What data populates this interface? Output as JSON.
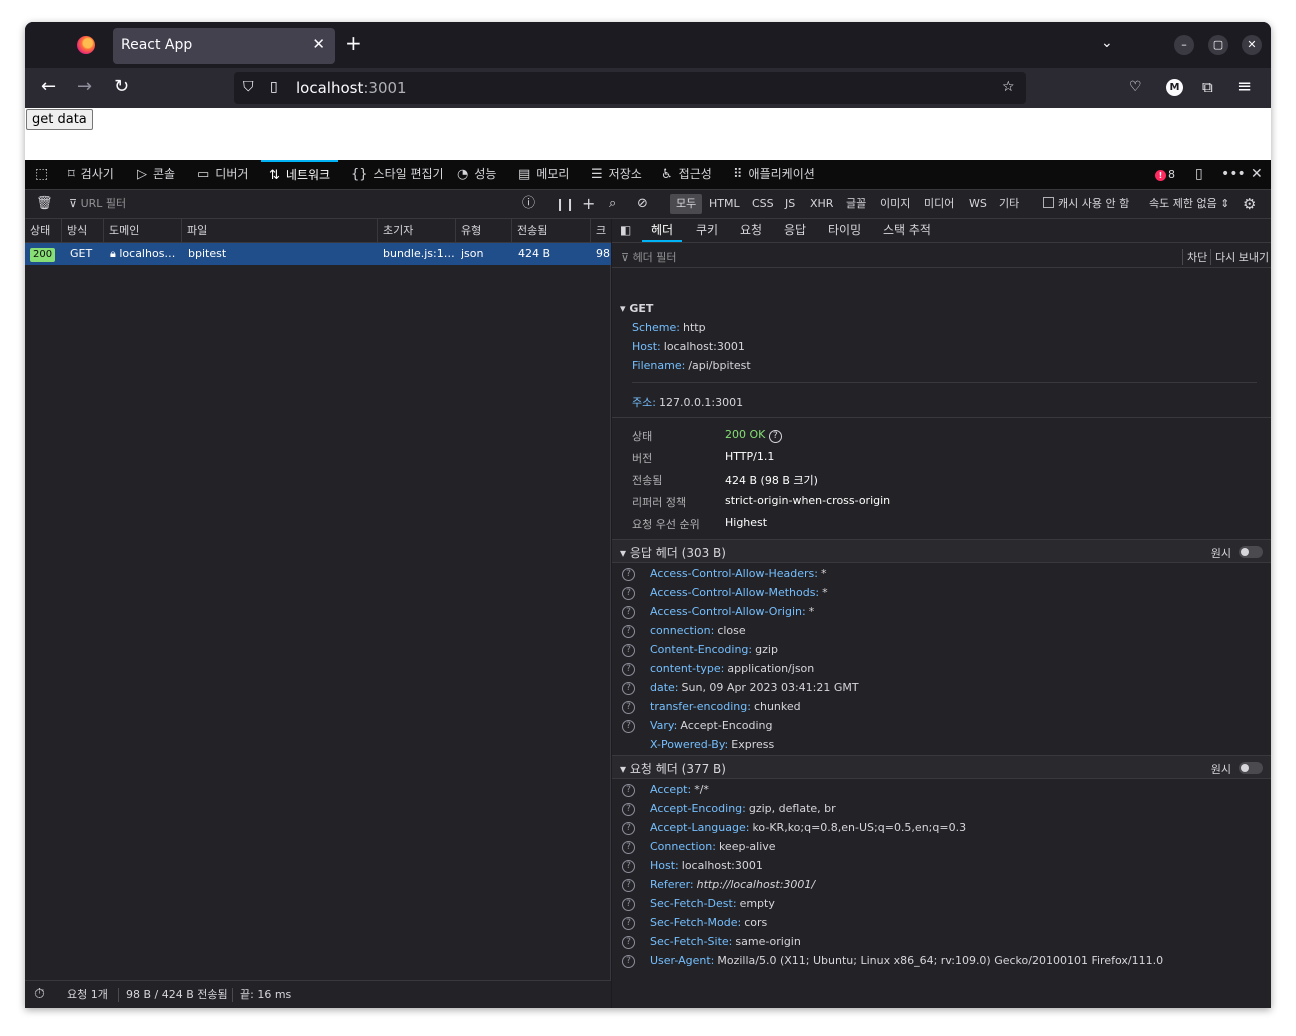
{
  "browser": {
    "tab_title": "React App",
    "url_host": "localhost",
    "url_port": ":3001"
  },
  "page": {
    "button_label": "get data"
  },
  "devtools": {
    "tools": [
      {
        "name": "inspector",
        "label": "검사기",
        "icon": "⌑"
      },
      {
        "name": "console",
        "label": "콘솔",
        "icon": "▷"
      },
      {
        "name": "debugger",
        "label": "디버거",
        "icon": "▭"
      },
      {
        "name": "network",
        "label": "네트워크",
        "icon": "⇅"
      },
      {
        "name": "style-editor",
        "label": "스타일 편집기",
        "icon": "{}"
      },
      {
        "name": "performance",
        "label": "성능",
        "icon": "◔"
      },
      {
        "name": "memory",
        "label": "메모리",
        "icon": "▤"
      },
      {
        "name": "storage",
        "label": "저장소",
        "icon": "☰"
      },
      {
        "name": "accessibility",
        "label": "접근성",
        "icon": "♿"
      },
      {
        "name": "application",
        "label": "애플리케이션",
        "icon": "⠿"
      }
    ],
    "error_count": "8",
    "filter": {
      "url_placeholder": "URL 필터",
      "types": [
        "모두",
        "HTML",
        "CSS",
        "JS",
        "XHR",
        "글꼴",
        "이미지",
        "미디어",
        "WS",
        "기타"
      ],
      "disable_cache": "캐시 사용 안 함",
      "throttle": "속도 제한 없음 ⇕"
    },
    "table": {
      "headers": [
        "상태",
        "방식",
        "도메인",
        "파일",
        "초기자",
        "유형",
        "전송됨",
        "크"
      ],
      "row": {
        "status": "200",
        "method": "GET",
        "domain": "localhos…",
        "file": "bpitest",
        "initiator": "bundle.js:1…",
        "type": "json",
        "transferred": "424 B",
        "size": "98"
      }
    },
    "statusbar": {
      "requests": "요청 1개",
      "transfer": "98 B / 424 B 전송됨",
      "finish": "끝: 16 ms"
    },
    "details": {
      "tabs": [
        "헤더",
        "쿠키",
        "요청",
        "응답",
        "타이밍",
        "스택 추적"
      ],
      "header_filter_placeholder": "헤더 필터",
      "block_label": "차단",
      "resend_label": "다시 보내기",
      "method": "GET",
      "scheme": {
        "k": "Scheme:",
        "v": "http"
      },
      "host": {
        "k": "Host:",
        "v": "localhost:3001"
      },
      "filename": {
        "k": "Filename:",
        "v": "/api/bpitest"
      },
      "address": {
        "k": "주소:",
        "v": "127.0.0.1:3001"
      },
      "summary": [
        {
          "label": "상태",
          "value": "200 OK"
        },
        {
          "label": "버전",
          "value": "HTTP/1.1"
        },
        {
          "label": "전송됨",
          "value": "424 B (98 B 크기)"
        },
        {
          "label": "리퍼러 정책",
          "value": "strict-origin-when-cross-origin"
        },
        {
          "label": "요청 우선 순위",
          "value": "Highest"
        }
      ],
      "response_headers_title": "응답 헤더 (303 B)",
      "request_headers_title": "요청 헤더 (377 B)",
      "raw_label": "원시",
      "response_headers": [
        {
          "k": "Access-Control-Allow-Headers:",
          "v": "*"
        },
        {
          "k": "Access-Control-Allow-Methods:",
          "v": "*"
        },
        {
          "k": "Access-Control-Allow-Origin:",
          "v": "*"
        },
        {
          "k": "connection:",
          "v": "close"
        },
        {
          "k": "Content-Encoding:",
          "v": "gzip"
        },
        {
          "k": "content-type:",
          "v": "application/json"
        },
        {
          "k": "date:",
          "v": "Sun, 09 Apr 2023 03:41:21 GMT"
        },
        {
          "k": "transfer-encoding:",
          "v": "chunked"
        },
        {
          "k": "Vary:",
          "v": "Accept-Encoding"
        },
        {
          "k": "X-Powered-By:",
          "v": "Express"
        }
      ],
      "request_headers": [
        {
          "k": "Accept:",
          "v": "*/*"
        },
        {
          "k": "Accept-Encoding:",
          "v": "gzip, deflate, br"
        },
        {
          "k": "Accept-Language:",
          "v": "ko-KR,ko;q=0.8,en-US;q=0.5,en;q=0.3"
        },
        {
          "k": "Connection:",
          "v": "keep-alive"
        },
        {
          "k": "Host:",
          "v": "localhost:3001"
        },
        {
          "k": "Referer:",
          "v": "http://localhost:3001/"
        },
        {
          "k": "Sec-Fetch-Dest:",
          "v": "empty"
        },
        {
          "k": "Sec-Fetch-Mode:",
          "v": "cors"
        },
        {
          "k": "Sec-Fetch-Site:",
          "v": "same-origin"
        },
        {
          "k": "User-Agent:",
          "v": "Mozilla/5.0 (X11; Ubuntu; Linux x86_64; rv:109.0) Gecko/20100101 Firefox/111.0"
        }
      ]
    }
  }
}
